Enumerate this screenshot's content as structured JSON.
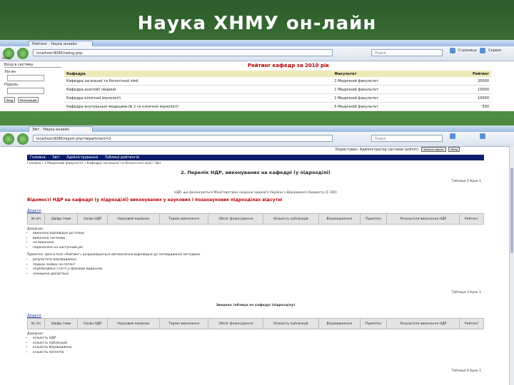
{
  "slide": {
    "title": "Наука ХНМУ он-лайн"
  },
  "browser1": {
    "tab_label": "Рейтинг - Наука онлайн",
    "url": "localhost:8080/rating.php",
    "search_placeholder": "Поиск",
    "back_label": "Назад",
    "forward_label": "Вперед",
    "page_label": "Страница",
    "tools_label": "Сервис"
  },
  "login": {
    "title": "Вход в систему",
    "login_label": "Логин",
    "password_label": "Пароль",
    "enter_button": "Вход",
    "register_button": "Регистрация"
  },
  "rating": {
    "title": "Рейтинг кафедр за 2010 рік",
    "headers": [
      "Кафедра",
      "Факультет",
      "Рейтинг"
    ],
    "rows": [
      [
        "Кафедра загальної та біологічної хімії",
        "1 Медичний факультет",
        "20000"
      ],
      [
        "Кафедра анатомії людини",
        "1 Медичний факультет",
        "15000"
      ],
      [
        "Кафедра клінічної імунології",
        "1 Медичний факультет",
        "10000"
      ],
      [
        "Кафедра внутрішньої медицини № 2 та клінічної імунології",
        "5 Медичний факультет",
        "500"
      ]
    ]
  },
  "browser2": {
    "tab_label": "Звіт - Наука онлайн",
    "url": "localhost:8080/report.php?department=2",
    "search_placeholder": "Поиск"
  },
  "report": {
    "user_text": "Користувач: Адміністратор системи (admin)",
    "user_buttons": [
      "Змінити пароль",
      "Вихід"
    ],
    "menu": [
      "Головна",
      "Звіт",
      "Адміністрування",
      "Таблиці рейтингів"
    ],
    "breadcrumb": "Головна / 1 Медичний факультет / Кафедра загальної та біологічної хімії / Звіт",
    "section_title": "2. Перелік НДР, виконуваних на кафедрі (у підрозділі)",
    "right_note1": "Таблиця 2 Крок 1",
    "org_line": "НДР, що фінансуються Міністерством охорони здоров'я України з Державного бюджету (1.100)",
    "red_heading": "Відомості НДР на кафедрі (у підрозділі) виконуваних у наукових і позанаукових підрозділах відсутні",
    "add_link": "Додати",
    "table_headers": [
      "№ з/п",
      "Шифр теми",
      "Назва НДР",
      "Науковий керівник",
      "Термін виконання",
      "Обсяг фінансування",
      "Кількість публікацій",
      "Впровадження",
      "Примітка",
      "Результати виконання НДР",
      "Рейтинг"
    ],
    "notes_title": "Довідник:",
    "notes1": [
      "виконано відповідно до плану",
      "виконано частково",
      "не виконано",
      "перенесено на наступний рік"
    ],
    "para1": "Примітка: дані в полі «Рейтинг» розраховуються автоматично відповідно до затвердженої методики.",
    "notes2": [
      "результати впроваджено",
      "подано заявку на патент",
      "опубліковано статті у фахових виданнях",
      "захищено дисертації"
    ],
    "section2_title": "Зведена таблиця по кафедрі (підрозділу)",
    "right_note2": "Таблиця 3 Крок 1",
    "add_link2": "Додати",
    "notes3": [
      "кількість НДР",
      "кількість публікацій",
      "кількість впроваджень",
      "кількість патентів"
    ],
    "right_note3": "Таблиця 4 Крок 1"
  }
}
